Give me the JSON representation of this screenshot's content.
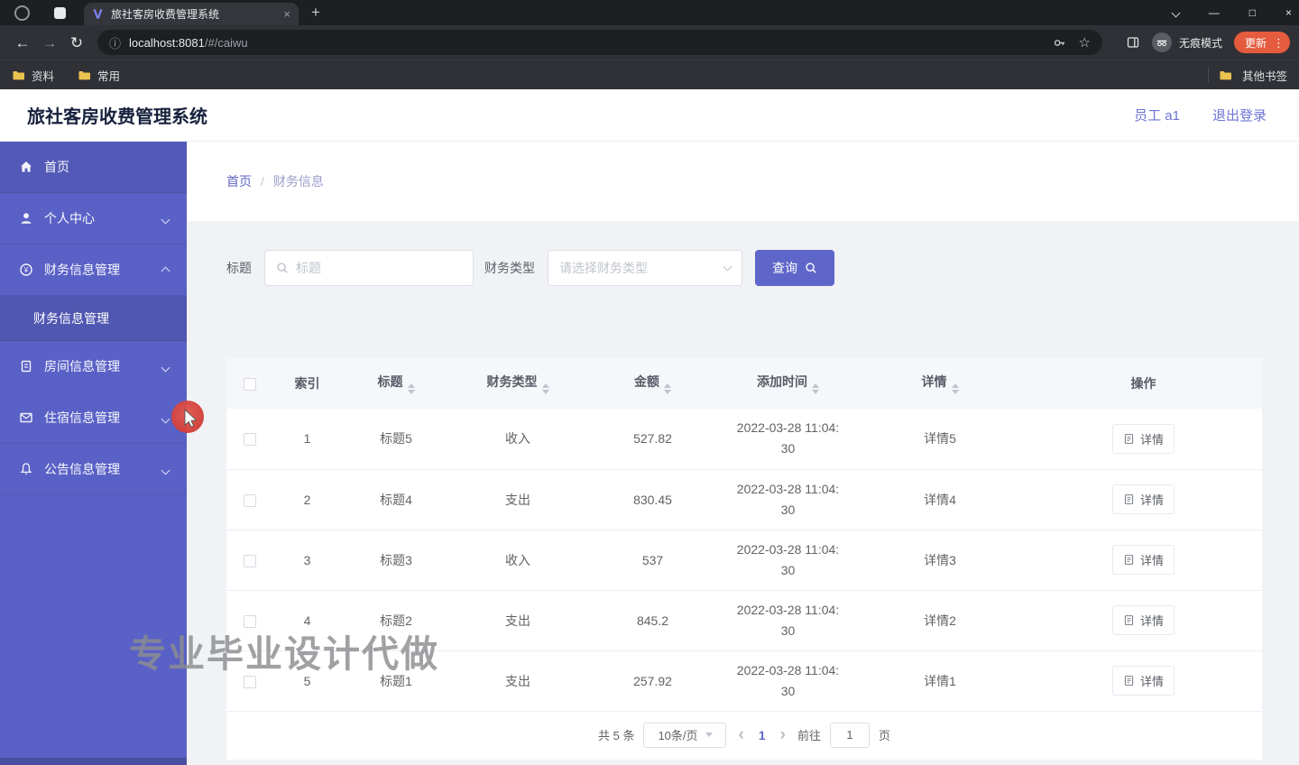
{
  "browser": {
    "tab_title": "旅社客房收费管理系统",
    "url_host": "localhost:8081",
    "url_path": "/#/caiwu",
    "bookmarks": [
      "资料",
      "常用"
    ],
    "other_bookmarks": "其他书签",
    "incognito_label": "无痕模式",
    "update_label": "更新"
  },
  "header": {
    "title": "旅社客房收费管理系统",
    "user": "员工 a1",
    "logout": "退出登录"
  },
  "sidebar": {
    "items": [
      {
        "label": "首页"
      },
      {
        "label": "个人中心"
      },
      {
        "label": "财务信息管理"
      },
      {
        "label": "房间信息管理"
      },
      {
        "label": "住宿信息管理"
      },
      {
        "label": "公告信息管理"
      }
    ],
    "submenu_active": "财务信息管理"
  },
  "page": {
    "breadcrumb": {
      "home": "首页",
      "separator": "/",
      "current": "财务信息"
    },
    "filters": {
      "title_label": "标题",
      "title_placeholder": "标题",
      "type_label": "财务类型",
      "type_placeholder": "请选择财务类型",
      "search_button": "查询"
    },
    "table": {
      "columns": [
        "索引",
        "标题",
        "财务类型",
        "金额",
        "添加时间",
        "详情",
        "操作"
      ],
      "action_label": "详情",
      "rows": [
        {
          "index": "1",
          "title": "标题5",
          "type": "收入",
          "amount": "527.82",
          "time": "2022-03-28 11:04:30",
          "detail": "详情5"
        },
        {
          "index": "2",
          "title": "标题4",
          "type": "支出",
          "amount": "830.45",
          "time": "2022-03-28 11:04:30",
          "detail": "详情4"
        },
        {
          "index": "3",
          "title": "标题3",
          "type": "收入",
          "amount": "537",
          "time": "2022-03-28 11:04:30",
          "detail": "详情3"
        },
        {
          "index": "4",
          "title": "标题2",
          "type": "支出",
          "amount": "845.2",
          "time": "2022-03-28 11:04:30",
          "detail": "详情2"
        },
        {
          "index": "5",
          "title": "标题1",
          "type": "支出",
          "amount": "257.92",
          "time": "2022-03-28 11:04:30",
          "detail": "详情1"
        }
      ]
    },
    "pagination": {
      "total": "共 5 条",
      "page_size": "10条/页",
      "page": "1",
      "goto_label": "前往",
      "goto_value": "1",
      "unit": "页"
    }
  },
  "watermark": "专业毕业设计代做",
  "colors": {
    "accent": "#5f66c9",
    "sidebar": "#5a61c6",
    "update_button": "#e45b3e"
  }
}
